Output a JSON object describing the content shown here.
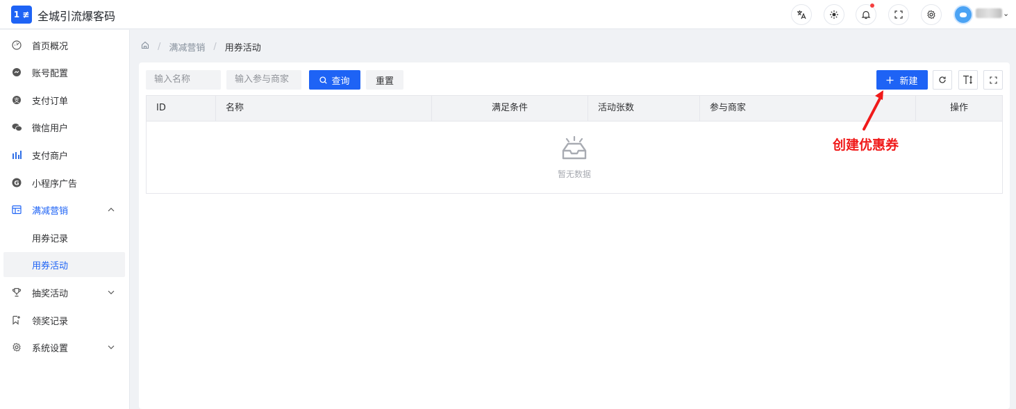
{
  "header": {
    "logo_text": "1 ≢",
    "title": "全城引流爆客码",
    "icons": [
      "translate-icon",
      "theme-sun-icon",
      "bell-icon",
      "fullscreen-icon",
      "gear-icon"
    ]
  },
  "sidebar": {
    "items": [
      {
        "label": "首页概况",
        "icon": "dashboard-icon"
      },
      {
        "label": "账号配置",
        "icon": "account-icon"
      },
      {
        "label": "支付订单",
        "icon": "order-icon"
      },
      {
        "label": "微信用户",
        "icon": "wechat-icon"
      },
      {
        "label": "支付商户",
        "icon": "chart-icon"
      },
      {
        "label": "小程序广告",
        "icon": "g-icon"
      },
      {
        "label": "满减营销",
        "icon": "marketing-icon",
        "expanded": true
      },
      {
        "label": "用券记录"
      },
      {
        "label": "用券活动",
        "active": true
      },
      {
        "label": "抽奖活动",
        "icon": "trophy-icon"
      },
      {
        "label": "领奖记录",
        "icon": "bookmark-icon"
      },
      {
        "label": "系统设置",
        "icon": "settings-icon"
      }
    ]
  },
  "breadcrumb": {
    "items": [
      "满减营销",
      "用券活动"
    ]
  },
  "toolbar": {
    "name_placeholder": "输入名称",
    "merchant_placeholder": "输入参与商家",
    "search_label": "查询",
    "reset_label": "重置",
    "new_label": "新建"
  },
  "table": {
    "columns": [
      "ID",
      "名称",
      "满足条件",
      "活动张数",
      "参与商家",
      "操作"
    ],
    "rows": [],
    "empty_text": "暂无数据"
  },
  "annotation": {
    "text": "创建优惠券",
    "color": "#f01a1a"
  },
  "colors": {
    "primary": "#1e63f5"
  }
}
